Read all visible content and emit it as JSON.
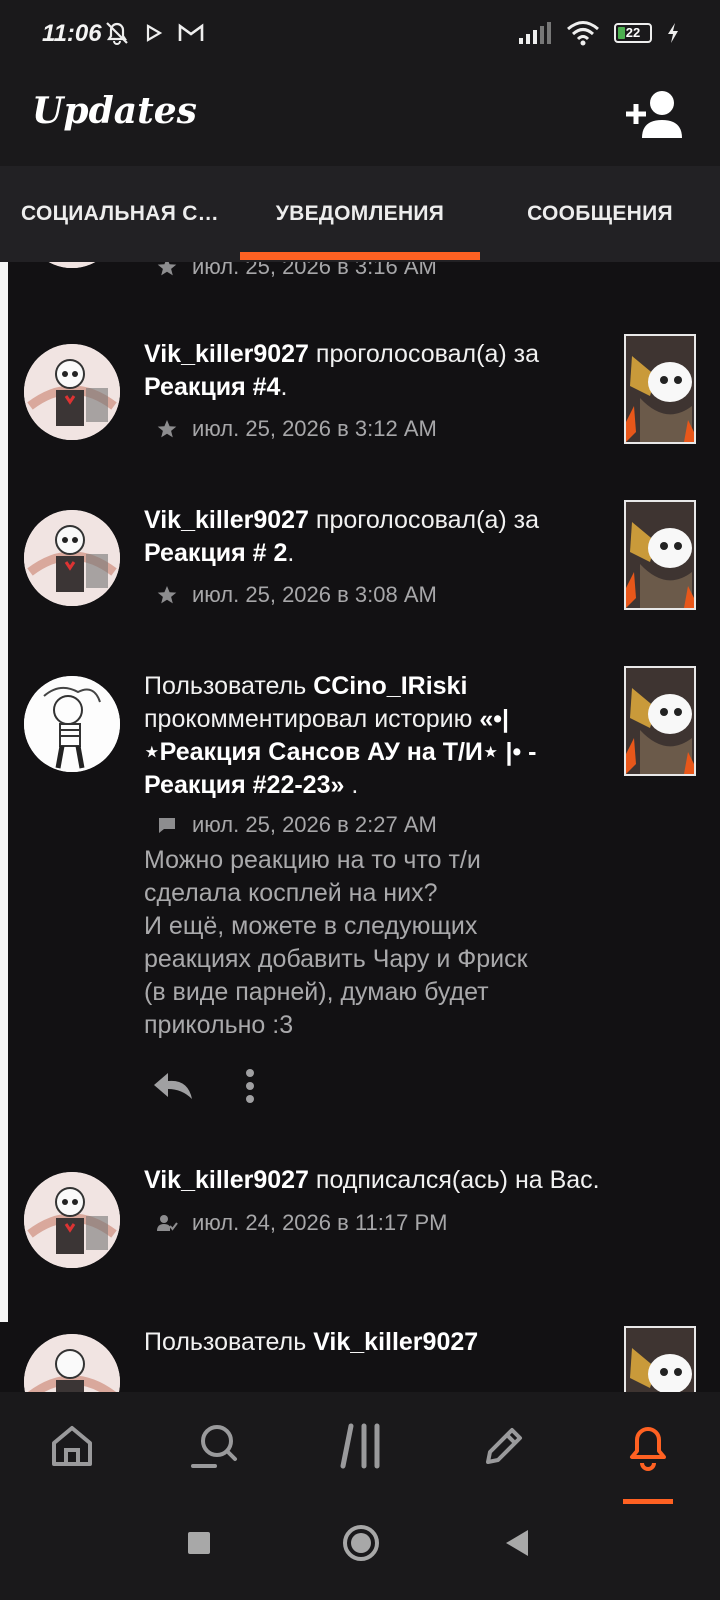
{
  "status_bar": {
    "time": "11:06",
    "battery": "22",
    "battery_level": 0.22
  },
  "app_bar": {
    "title": "Updates"
  },
  "tabs": [
    {
      "label": "СОЦИАЛЬНАЯ С…"
    },
    {
      "label": "УВЕДОМЛЕНИЯ",
      "active": true
    },
    {
      "label": "СООБЩЕНИЯ"
    }
  ],
  "feed": {
    "items": [
      {
        "meta_icon": "star-icon",
        "timestamp": "июл. 25, 2026 в 3:16 AM"
      },
      {
        "user": "Vik_killer9027",
        "action": " проголосовал(а) за",
        "target": "Реакция #4",
        "suffix": ".",
        "meta_icon": "star-icon",
        "timestamp": "июл. 25, 2026 в 3:12 AM"
      },
      {
        "user": "Vik_killer9027",
        "action": " проголосовал(а) за",
        "target": "Реакция # 2",
        "suffix": ".",
        "meta_icon": "star-icon",
        "timestamp": "июл. 25, 2026 в 3:08 AM"
      },
      {
        "prefix": "Пользователь ",
        "user": "CCino_IRiski",
        "action": " прокомментировал историю ",
        "target": "«•|⋆Реакция Сансов АУ на Т/И⋆ |• - Реакция #22-23»",
        "suffix": " .",
        "meta_icon": "comment-icon",
        "timestamp": "июл. 25, 2026 в 2:27 AM",
        "comment": "Можно реакцию на то что т/и\nсделала косплей на них?\nИ ещё, можете в следующих\nреакциях добавить Чару и Фриск\n(в виде парней), думаю будет\nприкольно :3"
      },
      {
        "user": "Vik_killer9027",
        "action": " подписался(ась) на Вас.",
        "meta_icon": "follow-icon",
        "timestamp": "июл. 24, 2026 в 11:17 PM"
      },
      {
        "prefix": "Пользователь ",
        "user": "Vik_killer9027"
      }
    ]
  },
  "colors": {
    "accent": "#ff6122",
    "background": "#121113",
    "bar": "#1a191b",
    "tab_bar": "#222124"
  }
}
